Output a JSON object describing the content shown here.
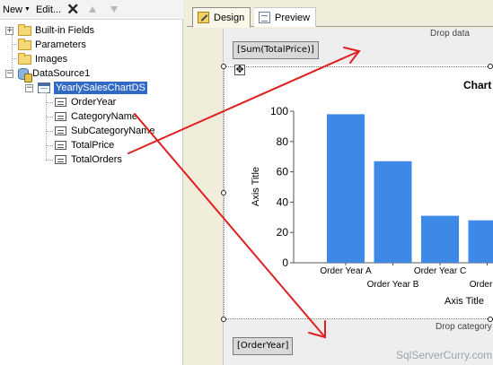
{
  "toolbar": {
    "new_label": "New",
    "edit_label": "Edit...",
    "delete_icon": "close-icon",
    "move_up_icon": "arrow-up-icon",
    "move_down_icon": "arrow-down-icon"
  },
  "tree": {
    "built_in_fields": "Built-in Fields",
    "parameters": "Parameters",
    "images": "Images",
    "datasource": "DataSource1",
    "dataset": "YearlySalesChartDS",
    "fields": [
      "OrderYear",
      "CategoryName",
      "SubCategoryName",
      "TotalPrice",
      "TotalOrders"
    ],
    "expanders": {
      "collapsed": "+",
      "expanded": "−"
    }
  },
  "tabs": [
    {
      "label": "Design",
      "icon": "design-icon",
      "selected": true
    },
    {
      "label": "Preview",
      "icon": "preview-icon",
      "selected": false
    }
  ],
  "design": {
    "drop_data_text": "Drop data",
    "data_field": "[Sum(TotalPrice)]",
    "drop_category_text": "Drop category",
    "category_field": "[OrderYear]",
    "move_handle_glyph": "✥"
  },
  "chart_data": {
    "type": "bar",
    "title": "Chart",
    "xlabel": "Axis Title",
    "ylabel": "Axis Title",
    "ylim": [
      0,
      100
    ],
    "yticks": [
      0,
      20,
      40,
      60,
      80,
      100
    ],
    "categories": [
      "Order Year A",
      "Order Year B",
      "Order Year C",
      "Order Ye"
    ],
    "values": [
      98,
      67,
      31,
      28
    ],
    "bar_color": "#3e88e8",
    "grid": false
  },
  "watermark": "SqlServerCurry.com",
  "annotation_arrow_color": "#e02020"
}
